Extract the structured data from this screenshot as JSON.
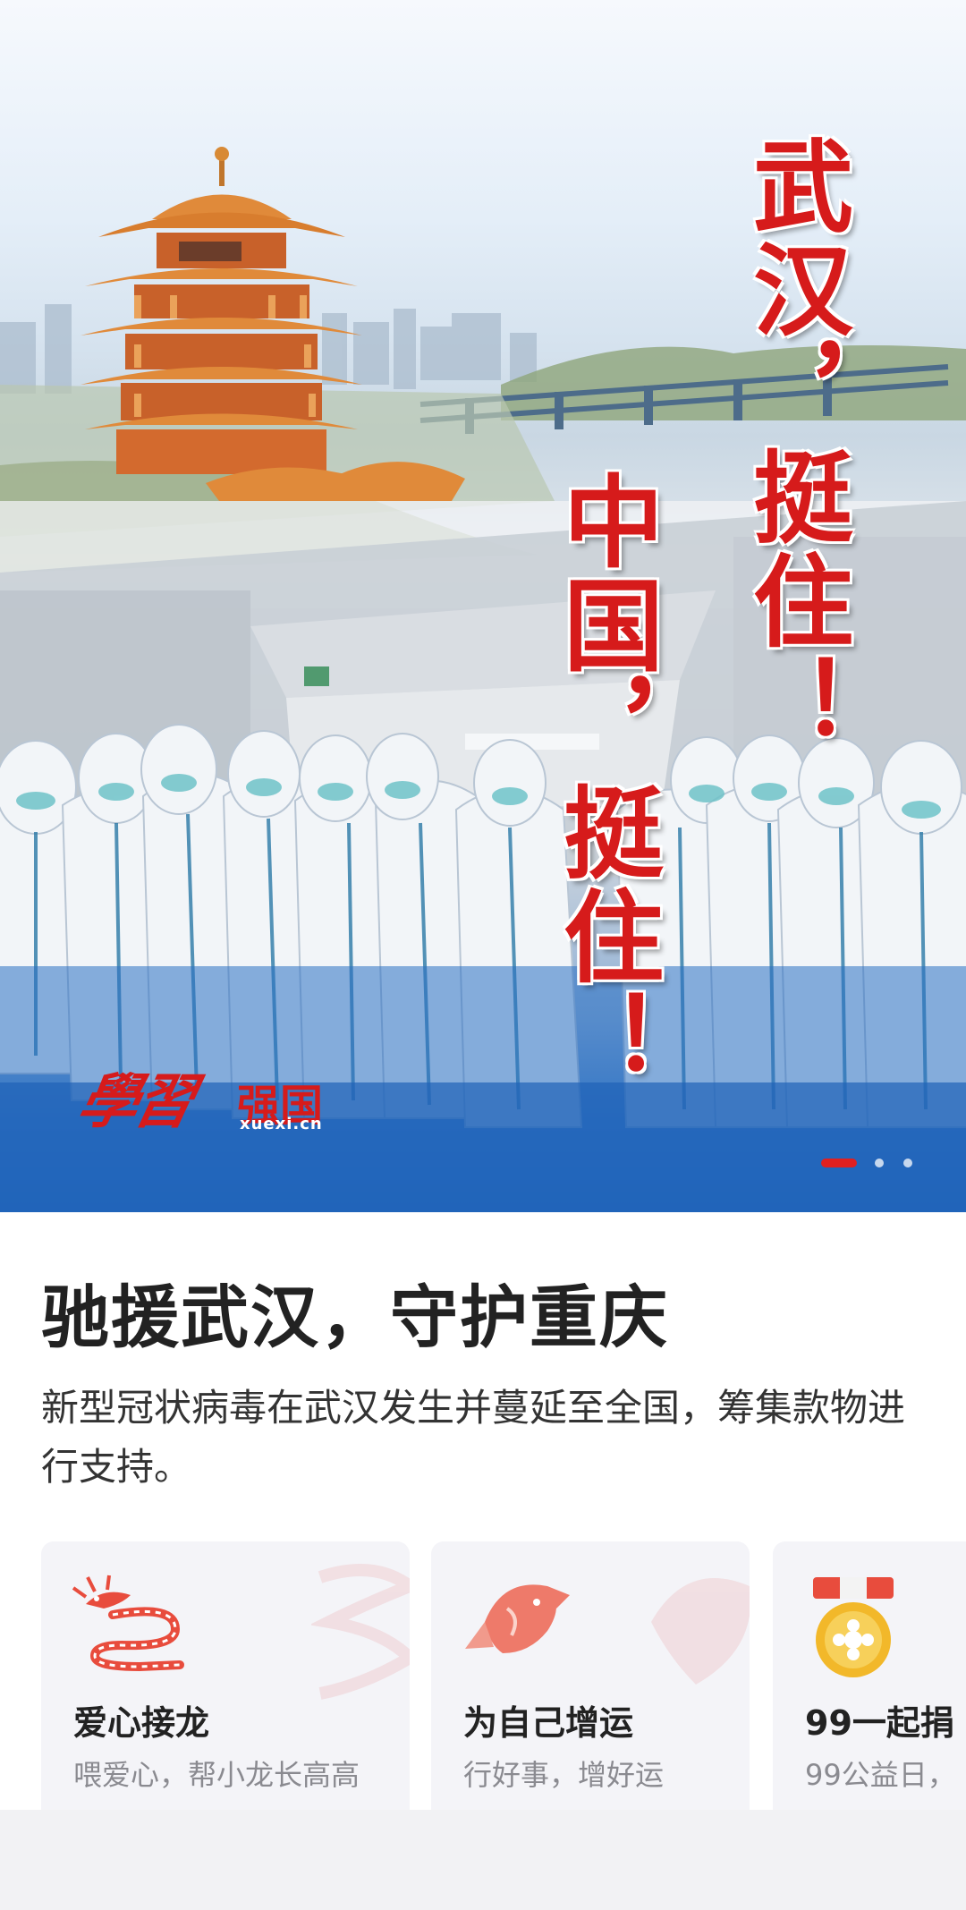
{
  "banner": {
    "slogan_1": "武汉，挺住！",
    "slogan_2": "中国，挺住！",
    "logo_script": "學習",
    "logo_strong": "强国",
    "logo_url": "xuexi.cn",
    "carousel_dots": 3,
    "carousel_active_index": 0
  },
  "content": {
    "headline": "驰援武汉，守护重庆",
    "description": "新型冠状病毒在武汉发生并蔓延至全国，筹集款物进行支持。"
  },
  "cards": [
    {
      "icon": "dragon-icon",
      "title": "爱心接龙",
      "subtitle": "喂爱心，帮小龙长高高"
    },
    {
      "icon": "koi-fish-icon",
      "title": "为自己增运",
      "subtitle": "行好事，增好运"
    },
    {
      "icon": "medal-icon",
      "title": "99一起捐",
      "subtitle": "99公益日，"
    }
  ],
  "colors": {
    "accent_red": "#d61b1b",
    "banner_blue": "#1e63b9",
    "card_bg": "#f4f4f8",
    "medal_gold": "#f2b82a"
  }
}
